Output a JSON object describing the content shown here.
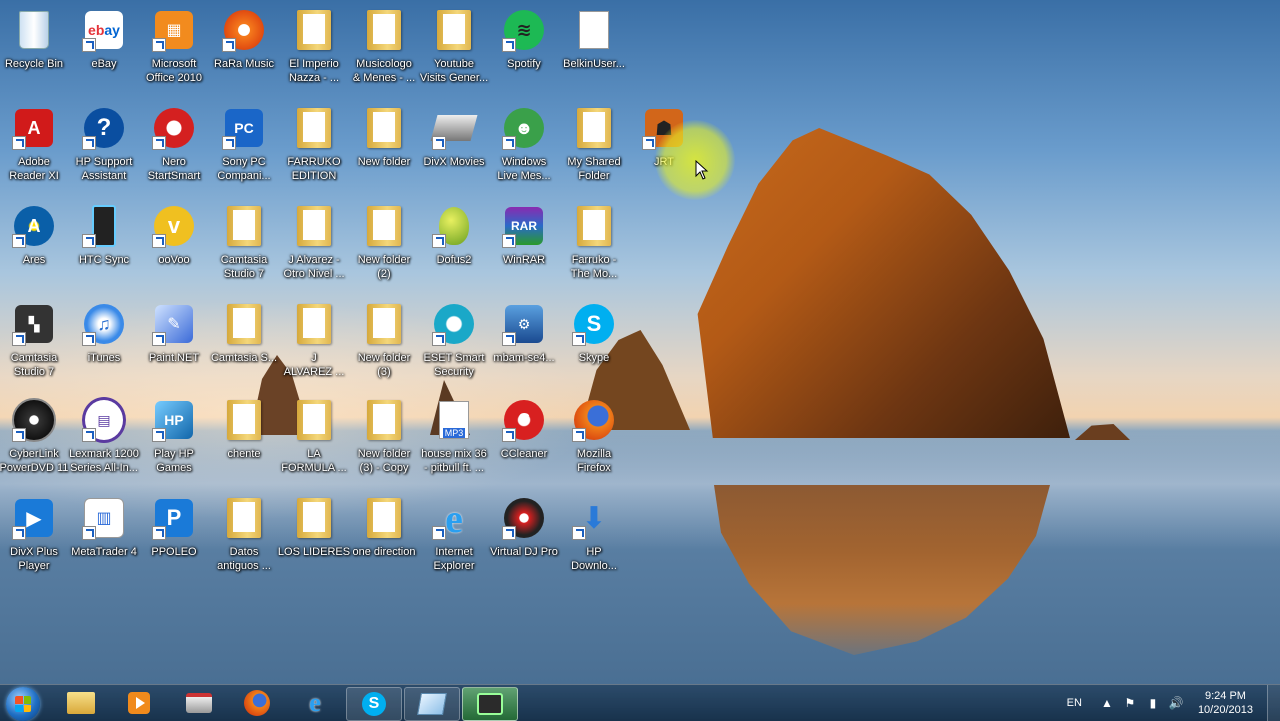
{
  "desktop": {
    "icons": [
      {
        "label": "Recycle Bin",
        "icon": "recycle-bin-icon"
      },
      {
        "label": "eBay",
        "icon": "ebay-icon"
      },
      {
        "label": "Microsoft\nOffice 2010",
        "icon": "office-icon"
      },
      {
        "label": "RaRa Music",
        "icon": "rara-music-icon"
      },
      {
        "label": "El Imperio\nNazza - ...",
        "icon": "folder-icon"
      },
      {
        "label": "Musicologo\n& Menes - ...",
        "icon": "folder-icon"
      },
      {
        "label": "Youtube\nVisits Gener...",
        "icon": "folder-icon"
      },
      {
        "label": "Spotify",
        "icon": "spotify-icon"
      },
      {
        "label": "BelkinUser...",
        "icon": "document-icon"
      },
      {
        "label": "Adobe\nReader XI",
        "icon": "adobe-reader-icon"
      },
      {
        "label": "HP Support\nAssistant",
        "icon": "hp-support-icon"
      },
      {
        "label": "Nero\nStartSmart",
        "icon": "nero-icon"
      },
      {
        "label": "Sony PC\nCompani...",
        "icon": "sony-pc-icon"
      },
      {
        "label": "FARRUKO\nEDITION",
        "icon": "folder-icon"
      },
      {
        "label": "New folder",
        "icon": "folder-icon"
      },
      {
        "label": "DivX Movies",
        "icon": "divx-movies-icon"
      },
      {
        "label": "Windows\nLive Mes...",
        "icon": "windows-live-icon"
      },
      {
        "label": "My Shared\nFolder",
        "icon": "folder-icon"
      },
      {
        "label": "JRT",
        "icon": "jrt-icon"
      },
      {
        "label": "Ares",
        "icon": "ares-icon"
      },
      {
        "label": "HTC Sync",
        "icon": "htc-sync-icon"
      },
      {
        "label": "ooVoo",
        "icon": "oovoo-icon"
      },
      {
        "label": "Camtasia\nStudio 7",
        "icon": "folder-icon"
      },
      {
        "label": "J Alvarez -\nOtro Nivel ...",
        "icon": "folder-icon"
      },
      {
        "label": "New folder\n(2)",
        "icon": "folder-icon"
      },
      {
        "label": "Dofus2",
        "icon": "dofus-icon"
      },
      {
        "label": "WinRAR",
        "icon": "winrar-icon"
      },
      {
        "label": "Farruko -\nThe Mo...",
        "icon": "folder-icon"
      },
      {
        "label": "Camtasia\nStudio 7",
        "icon": "camtasia-icon"
      },
      {
        "label": "iTunes",
        "icon": "itunes-icon"
      },
      {
        "label": "Paint.NET",
        "icon": "paintnet-icon"
      },
      {
        "label": "Camtasia S...",
        "icon": "folder-icon"
      },
      {
        "label": "J\nALVAREZ ...",
        "icon": "folder-icon"
      },
      {
        "label": "New folder\n(3)",
        "icon": "folder-icon"
      },
      {
        "label": "ESET Smart\nSecurity",
        "icon": "eset-icon"
      },
      {
        "label": "mbam-se4...",
        "icon": "mbam-icon"
      },
      {
        "label": "Skype",
        "icon": "skype-icon"
      },
      {
        "label": "CyberLink\nPowerDVD 11",
        "icon": "powerdvd-icon"
      },
      {
        "label": "Lexmark 1200\nSeries All-In...",
        "icon": "lexmark-icon"
      },
      {
        "label": "Play HP\nGames",
        "icon": "hp-games-icon"
      },
      {
        "label": "chente",
        "icon": "folder-icon"
      },
      {
        "label": "LA\nFORMULA ...",
        "icon": "folder-icon"
      },
      {
        "label": "New folder\n(3) - Copy",
        "icon": "folder-icon"
      },
      {
        "label": "house mix 36\n- pitbull ft. ...",
        "icon": "mp3-icon"
      },
      {
        "label": "CCleaner",
        "icon": "ccleaner-icon"
      },
      {
        "label": "Mozilla\nFirefox",
        "icon": "firefox-icon"
      },
      {
        "label": "DivX Plus\nPlayer",
        "icon": "divx-player-icon"
      },
      {
        "label": "MetaTrader 4",
        "icon": "metatrader-icon"
      },
      {
        "label": "PPOLEO",
        "icon": "ppoleo-icon"
      },
      {
        "label": "Datos\nantiguos ...",
        "icon": "folder-icon"
      },
      {
        "label": "LOS LIDERES",
        "icon": "folder-icon"
      },
      {
        "label": "one direction",
        "icon": "folder-icon"
      },
      {
        "label": "Internet\nExplorer",
        "icon": "internet-explorer-icon"
      },
      {
        "label": "Virtual DJ Pro",
        "icon": "virtual-dj-icon"
      },
      {
        "label": "HP\nDownlo...",
        "icon": "hp-download-icon"
      }
    ]
  },
  "taskbar": {
    "pinned": [
      {
        "name": "windows-explorer",
        "icon": "folder-icon"
      },
      {
        "name": "media-player",
        "icon": "media-player-icon"
      },
      {
        "name": "printer",
        "icon": "printer-icon"
      },
      {
        "name": "firefox",
        "icon": "firefox-icon"
      },
      {
        "name": "internet-explorer",
        "icon": "internet-explorer-icon"
      },
      {
        "name": "skype",
        "icon": "skype-icon"
      },
      {
        "name": "window-app",
        "icon": "window-icon"
      },
      {
        "name": "camtasia-recorder",
        "icon": "camtasia-recorder-icon"
      }
    ],
    "tray": {
      "language": "EN",
      "time": "9:24 PM",
      "date": "10/20/2013"
    }
  }
}
